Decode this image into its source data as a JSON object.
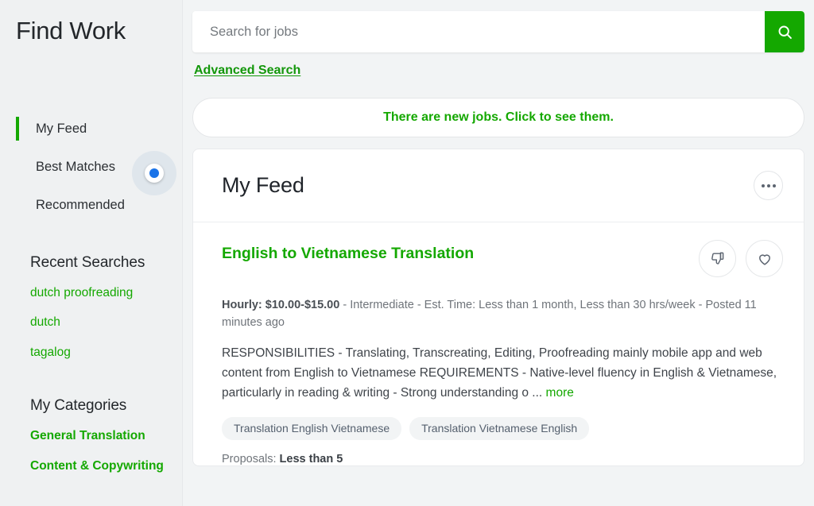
{
  "sidebar": {
    "brand_title": "Find Work",
    "nav": [
      {
        "label": "My Feed",
        "active": true
      },
      {
        "label": "Best Matches",
        "active": false
      },
      {
        "label": "Recommended",
        "active": false
      }
    ],
    "recent_searches": {
      "title": "Recent Searches",
      "items": [
        {
          "label": "dutch proofreading"
        },
        {
          "label": "dutch"
        },
        {
          "label": "tagalog"
        }
      ]
    },
    "my_categories": {
      "title": "My Categories",
      "items": [
        {
          "label": "General Translation"
        },
        {
          "label": "Content & Copywriting"
        }
      ]
    }
  },
  "search": {
    "value": "",
    "placeholder": "Search for jobs",
    "button_icon": "search-icon",
    "advanced_label": "Advanced Search"
  },
  "banner": {
    "text": "There are new jobs. Click to see them."
  },
  "feed": {
    "title": "My Feed",
    "menu_icon": "ellipsis-icon",
    "jobs": [
      {
        "title": "English to Vietnamese Translation",
        "meta_bold": "Hourly: $10.00-$15.00",
        "meta_rest": " - Intermediate - Est. Time: Less than 1 month, Less than 30 hrs/week - Posted 11 minutes ago",
        "description": "RESPONSIBILITIES - Translating, Transcreating, Editing, Proofreading mainly mobile app and web content from English to Vietnamese REQUIREMENTS - Native-level fluency in English & Vietnamese, particularly in reading & writing - Strong understanding o ... ",
        "more_label": "more",
        "tags": [
          "Translation English Vietnamese",
          "Translation Vietnamese English"
        ],
        "proposals_label": "Proposals: ",
        "proposals_value": "Less than 5",
        "dislike_icon": "thumbs-down-icon",
        "save_icon": "heart-icon"
      }
    ]
  },
  "colors": {
    "brand_green": "#14a800",
    "page_background": "#f2f4f5",
    "sidebar_background": "#eff1f2",
    "cursor_blue": "#1a73e8"
  }
}
